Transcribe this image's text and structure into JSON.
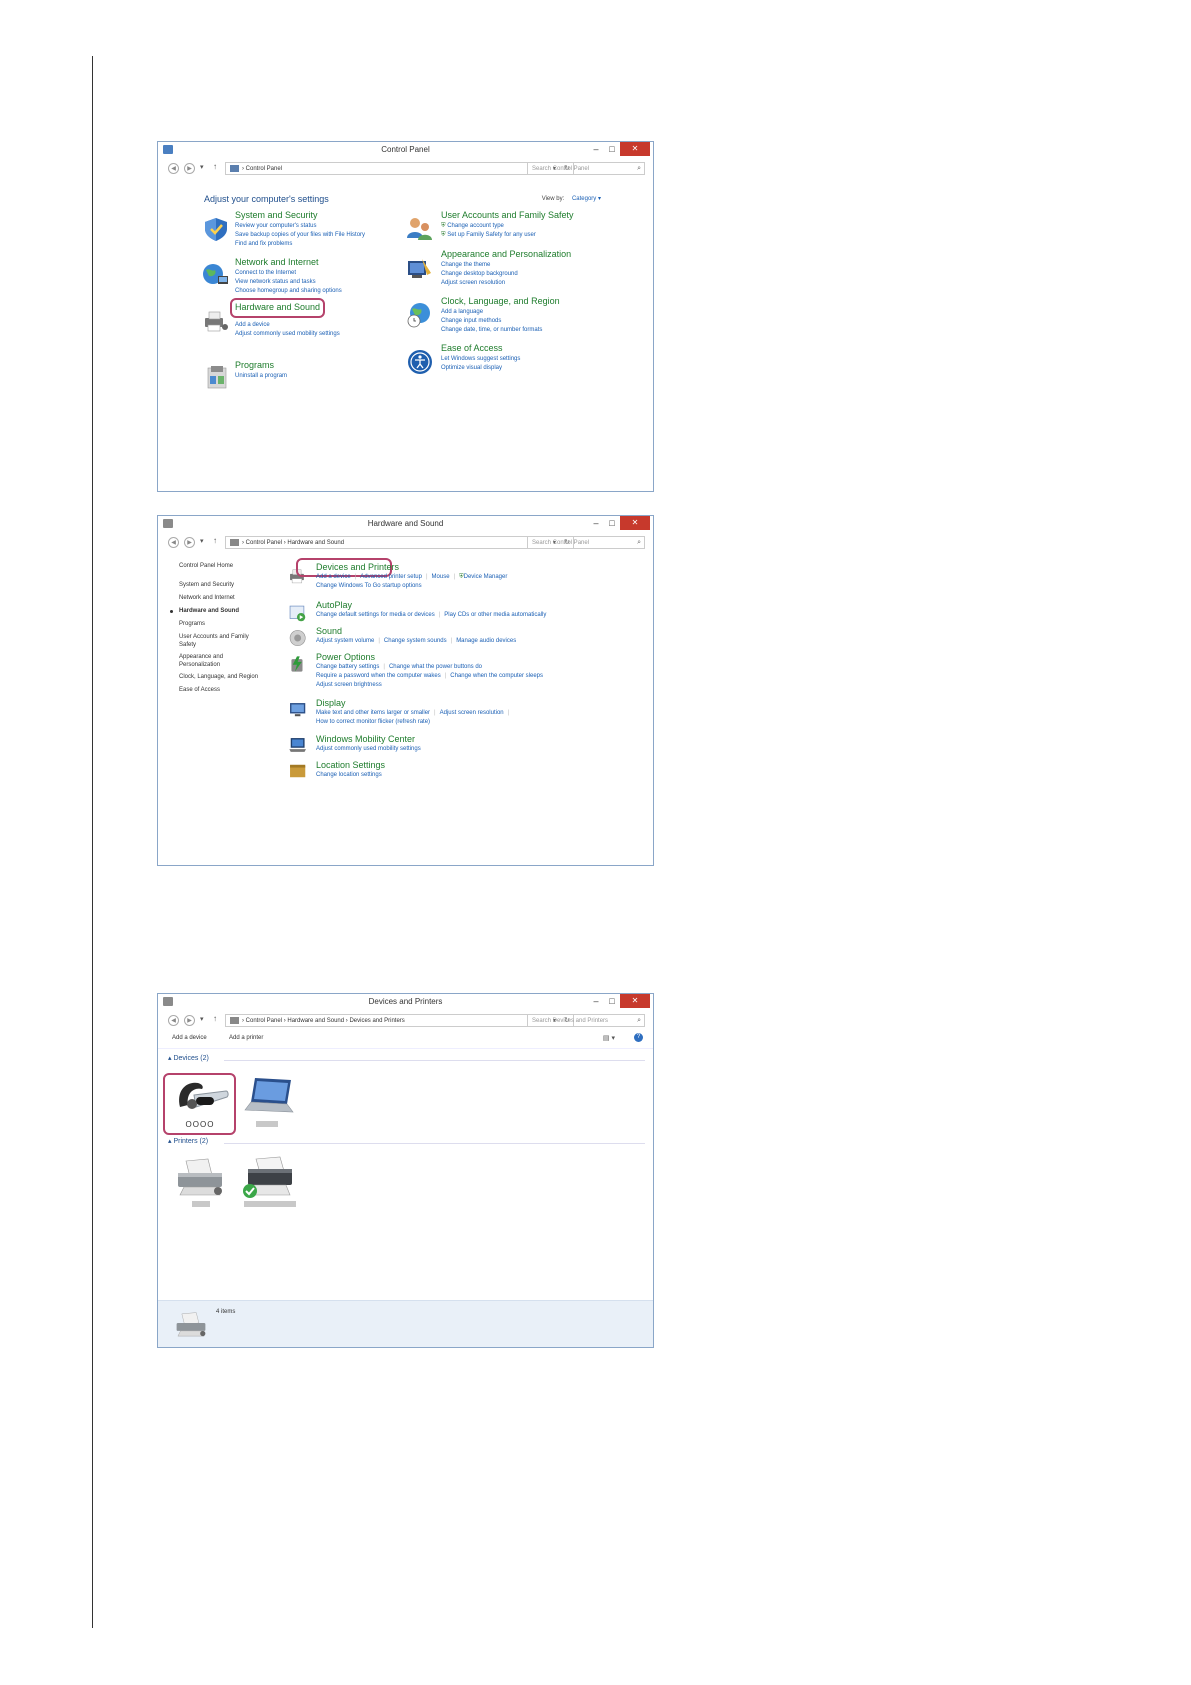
{
  "window1": {
    "title": "Control Panel",
    "breadcrumb": [
      "Control Panel"
    ],
    "search_placeholder": "Search Control Panel",
    "heading": "Adjust your computer's settings",
    "view_by_label": "View by:",
    "view_by_value": "Category",
    "left_categories": [
      {
        "title": "System and Security",
        "links": [
          "Review your computer's status",
          "Save backup copies of your files with File History",
          "Find and fix problems"
        ]
      },
      {
        "title": "Network and Internet",
        "links": [
          "Connect to the Internet",
          "View network status and tasks",
          "Choose homegroup and sharing options"
        ]
      },
      {
        "title": "Hardware and Sound",
        "links": [
          "Add a device",
          "Adjust commonly used mobility settings"
        ]
      },
      {
        "title": "Programs",
        "links": [
          "Uninstall a program"
        ]
      }
    ],
    "right_categories": [
      {
        "title": "User Accounts and Family Safety",
        "links": [
          "Change account type",
          "Set up Family Safety for any user"
        ]
      },
      {
        "title": "Appearance and Personalization",
        "links": [
          "Change the theme",
          "Change desktop background",
          "Adjust screen resolution"
        ]
      },
      {
        "title": "Clock, Language, and Region",
        "links": [
          "Add a language",
          "Change input methods",
          "Change date, time, or number formats"
        ]
      },
      {
        "title": "Ease of Access",
        "links": [
          "Let Windows suggest settings",
          "Optimize visual display"
        ]
      }
    ]
  },
  "window2": {
    "title": "Hardware and Sound",
    "breadcrumb": [
      "Control Panel",
      "Hardware and Sound"
    ],
    "search_placeholder": "Search Control Panel",
    "sidebar": [
      "Control Panel Home",
      "System and Security",
      "Network and Internet",
      "Hardware and Sound",
      "Programs",
      "User Accounts and Family Safety",
      "Appearance and Personalization",
      "Clock, Language, and Region",
      "Ease of Access"
    ],
    "sections": [
      {
        "title": "Devices and Printers",
        "lines": [
          [
            "Add a device",
            "Advanced printer setup",
            "Mouse",
            "Device Manager"
          ],
          [
            "Change Windows To Go startup options"
          ]
        ]
      },
      {
        "title": "AutoPlay",
        "lines": [
          [
            "Change default settings for media or devices",
            "Play CDs or other media automatically"
          ]
        ]
      },
      {
        "title": "Sound",
        "lines": [
          [
            "Adjust system volume",
            "Change system sounds",
            "Manage audio devices"
          ]
        ]
      },
      {
        "title": "Power Options",
        "lines": [
          [
            "Change battery settings",
            "Change what the power buttons do"
          ],
          [
            "Require a password when the computer wakes",
            "Change when the computer sleeps"
          ],
          [
            "Adjust screen brightness"
          ]
        ]
      },
      {
        "title": "Display",
        "lines": [
          [
            "Make text and other items larger or smaller",
            "Adjust screen resolution"
          ],
          [
            "How to correct monitor flicker (refresh rate)"
          ]
        ]
      },
      {
        "title": "Windows Mobility Center",
        "lines": [
          [
            "Adjust commonly used mobility settings"
          ]
        ]
      },
      {
        "title": "Location Settings",
        "lines": [
          [
            "Change location settings"
          ]
        ]
      }
    ]
  },
  "window3": {
    "title": "Devices and Printers",
    "breadcrumb": [
      "Control Panel",
      "Hardware and Sound",
      "Devices and Printers"
    ],
    "search_placeholder": "Search Devices and Printers",
    "toolbar": [
      "Add a device",
      "Add a printer"
    ],
    "devices_header": "Devices (2)",
    "printers_header": "Printers (2)",
    "headset_label": "OOOO",
    "status_text": "4 items"
  },
  "colors": {
    "accent_link": "#1a5fb4",
    "category_green": "#1e7c2c",
    "highlight": "#b5426b",
    "close_red": "#c7392c"
  }
}
